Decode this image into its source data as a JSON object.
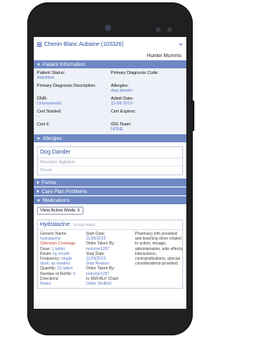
{
  "header": {
    "patient_title": "Chenin Blanc Aubaine (103326)",
    "clinician": "Hunter Mumms"
  },
  "patient_info": {
    "section_title": "Patient Information",
    "status_label": "Patient Status:",
    "status_value": "Admitted",
    "primary_dx_code_label": "Primary Diagnosis Code:",
    "primary_dx_desc_label": "Primary Diagnosis Description:",
    "allergies_label": "Allergies:",
    "allergies_value": "dog dander",
    "dnr_label": "DNR:",
    "dnr_value": "Unanswered",
    "admit_label": "Admit Date:",
    "admit_value": "11-08-2019",
    "cert_started_label": "Cert Started:",
    "cert_started_value": "--",
    "cert_expires_label": "Cert Expires:",
    "cert_num_label": "Cert #:",
    "idg_label": "IDG Team:",
    "idg_value": "NONE"
  },
  "allergies": {
    "section_title": "Allergies",
    "items": [
      {
        "name": "Dog Dander",
        "reaction": "Reaction: Agitated",
        "onset": "Onset:"
      }
    ]
  },
  "sections": {
    "forms": "Forms",
    "care_plan": "Care Plan Problems",
    "medications": "Medications"
  },
  "medications": {
    "view_filter": "View Active Meds",
    "items": [
      {
        "name": "Hydralazine",
        "strength": "- 10 Mg Tablet",
        "col1": [
          {
            "label": "Generic Name:",
            "value": ""
          },
          {
            "label": "",
            "value": "hydralazine"
          },
          {
            "label": "",
            "value": "Unknown Coverage",
            "red": true
          },
          {
            "label": "Dose: ",
            "value": "1 tablet"
          },
          {
            "label": "Route: ",
            "value": "by mouth"
          },
          {
            "label": "Frequency: ",
            "value": "single"
          },
          {
            "label": "",
            "value": "dose, as needed"
          },
          {
            "label": "Quantity: ",
            "value": "21 tablet"
          },
          {
            "label": "Number of Refills: ",
            "value": "0"
          },
          {
            "label": "Directions:",
            "value": ""
          },
          {
            "label": "",
            "value": "Notes:"
          }
        ],
        "col2": [
          {
            "label": "Start Date:",
            "value": ""
          },
          {
            "label": "",
            "value": "11/08/2019"
          },
          {
            "label": "Order Taken By:",
            "value": ""
          },
          {
            "label": "",
            "value": "mdoctor1287"
          },
          {
            "label": "Stop Date:",
            "value": ""
          },
          {
            "label": "",
            "value": "11/29/2019"
          },
          {
            "label": "",
            "value": "Stop Reason:"
          },
          {
            "label": "Order Taken By:",
            "value": ""
          },
          {
            "label": "",
            "value": "mdoctor1287"
          },
          {
            "label": "In SNF/ALF Chart:",
            "value": ""
          },
          {
            "label": "",
            "value": "Order Verified:"
          }
        ],
        "col3": "Pharmacy info provided and teaching done related to action, dosage, administration, side effects, interactions, contraindications, special considerations provided."
      }
    ]
  }
}
